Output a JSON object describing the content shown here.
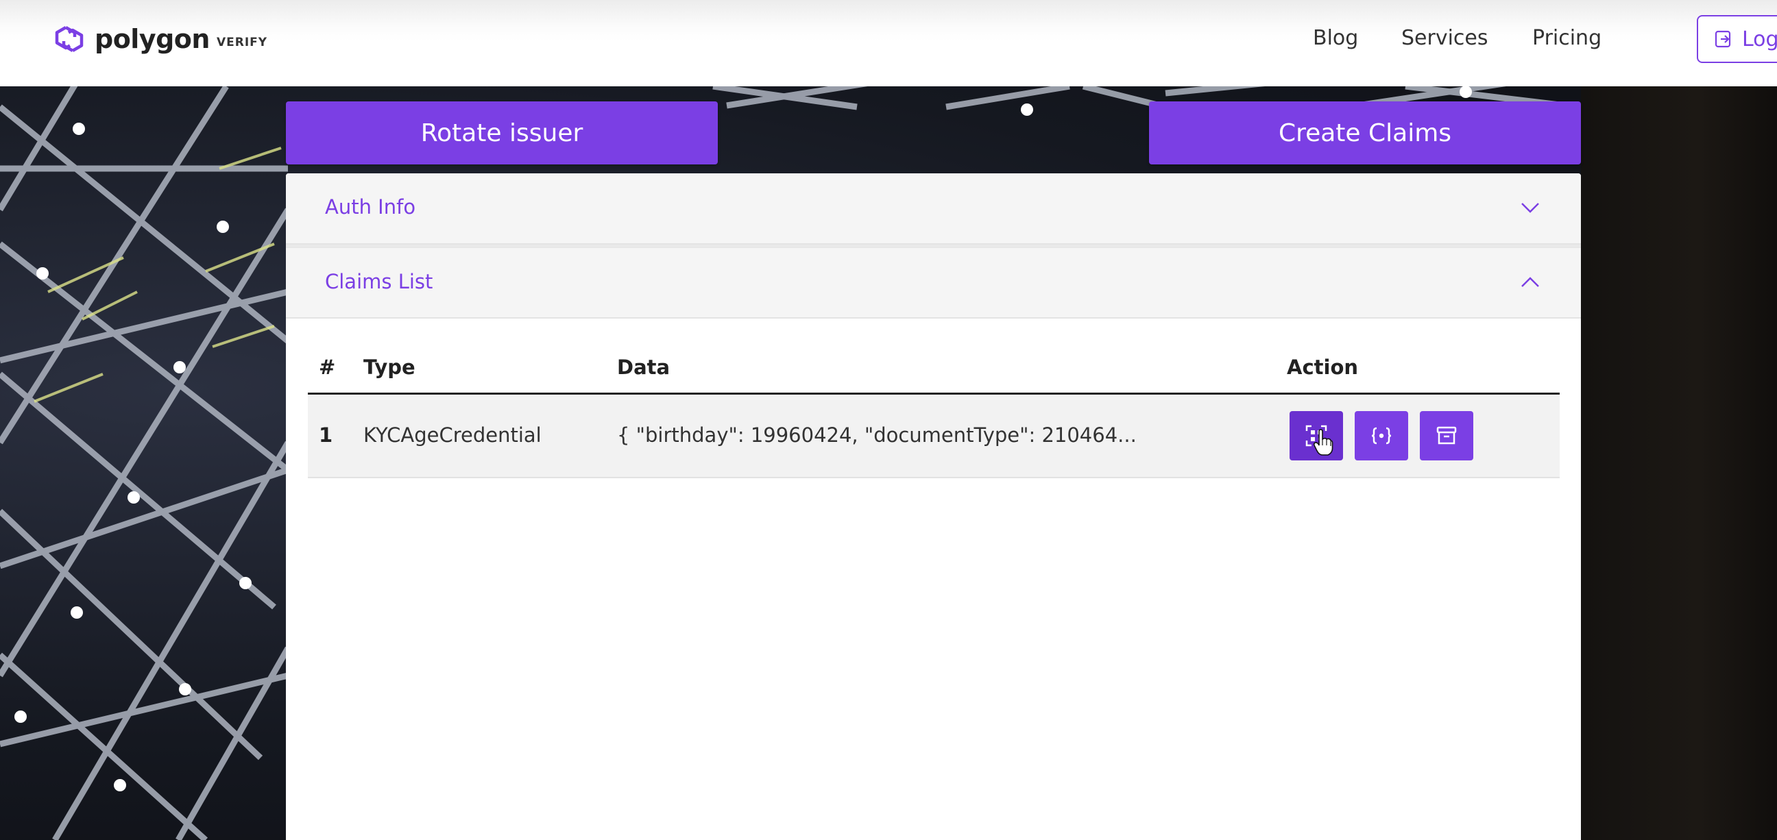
{
  "brand": {
    "name": "polygon",
    "sub": "VERIFY",
    "logo_icon": "polygon-logo-icon"
  },
  "nav": {
    "blog": "Blog",
    "services": "Services",
    "pricing": "Pricing",
    "login": "Log",
    "login_icon": "login-icon"
  },
  "actions": {
    "rotate_issuer": "Rotate issuer",
    "create_claims": "Create Claims"
  },
  "accordion": {
    "auth_info": {
      "title": "Auth Info",
      "state": "collapsed",
      "icon": "chevron-down-icon"
    },
    "claims_list": {
      "title": "Claims List",
      "state": "expanded",
      "icon": "chevron-up-icon"
    }
  },
  "table": {
    "headers": {
      "num": "#",
      "type": "Type",
      "data": "Data",
      "action": "Action"
    },
    "rows": [
      {
        "num": "1",
        "type": "KYCAgeCredential",
        "data": "{ \"birthday\": 19960424, \"documentType\": 210464...",
        "action_icons": [
          "qr-code-icon",
          "json-braces-icon",
          "archive-icon"
        ]
      }
    ]
  },
  "colors": {
    "accent": "#7b3fe4",
    "accent_pressed": "#6a30cf",
    "header_bg": "#f5f5f5",
    "row_bg": "#f2f2f2"
  }
}
